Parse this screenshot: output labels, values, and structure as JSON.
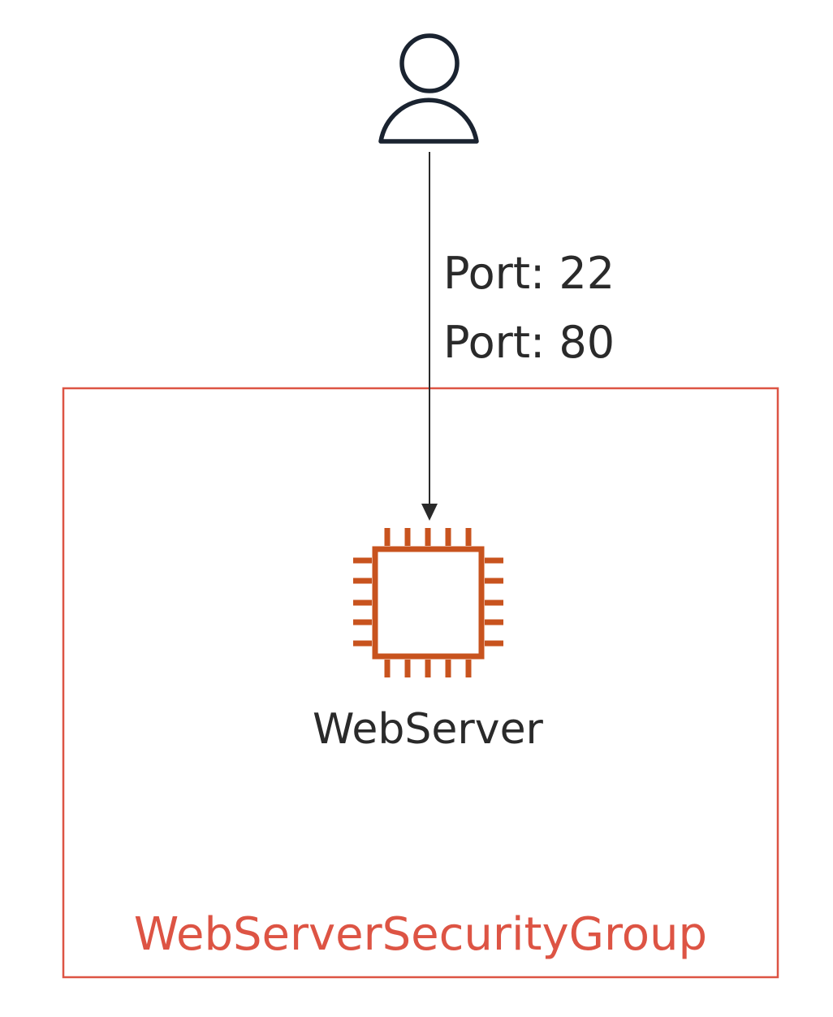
{
  "diagram": {
    "user": {
      "icon": "user-icon"
    },
    "connection": {
      "ports": [
        "Port: 22",
        "Port: 80"
      ]
    },
    "instance": {
      "icon": "ec2-chip-icon",
      "label": "WebServer"
    },
    "security_group": {
      "label": "WebServerSecurityGroup"
    },
    "colors": {
      "group_border": "#dd5444",
      "chip": "#c8531e",
      "line": "#2a2a2a",
      "user": "#1a2330"
    }
  }
}
